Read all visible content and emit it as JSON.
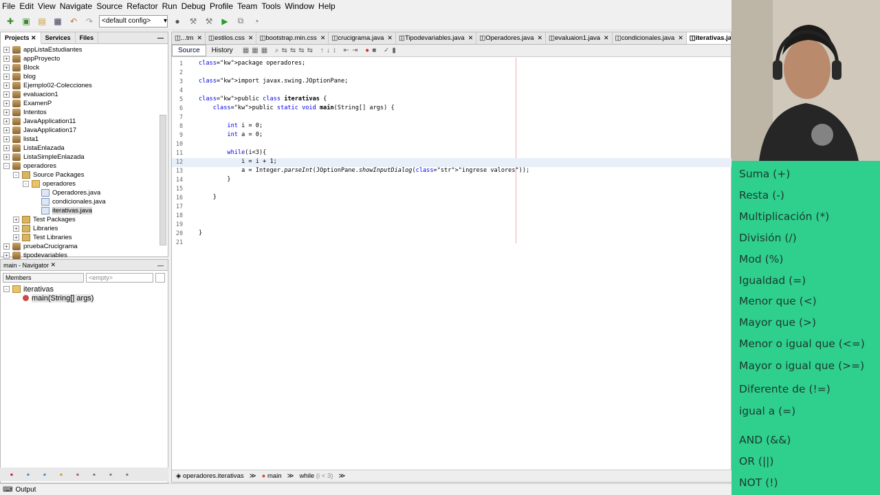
{
  "menu": [
    "File",
    "Edit",
    "View",
    "Navigate",
    "Source",
    "Refactor",
    "Run",
    "Debug",
    "Profile",
    "Team",
    "Tools",
    "Window",
    "Help"
  ],
  "toolbar": {
    "config": "<default config>"
  },
  "left_tabs": [
    "Projects",
    "Services",
    "Files"
  ],
  "tree": [
    {
      "label": "appListaEstudiantes",
      "level": 0,
      "icon": "proj",
      "toggle": "+"
    },
    {
      "label": "appProyecto",
      "level": 0,
      "icon": "proj",
      "toggle": "+"
    },
    {
      "label": "Block",
      "level": 0,
      "icon": "proj",
      "toggle": "+"
    },
    {
      "label": "blog",
      "level": 0,
      "icon": "proj",
      "toggle": "+"
    },
    {
      "label": "Ejemplo02-Colecciones",
      "level": 0,
      "icon": "proj",
      "toggle": "+"
    },
    {
      "label": "evaluacion1",
      "level": 0,
      "icon": "proj",
      "toggle": "+"
    },
    {
      "label": "ExamenP",
      "level": 0,
      "icon": "proj",
      "toggle": "+"
    },
    {
      "label": "Intentos",
      "level": 0,
      "icon": "proj",
      "toggle": "+"
    },
    {
      "label": "JavaApplication11",
      "level": 0,
      "icon": "proj",
      "toggle": "+"
    },
    {
      "label": "JavaApplication17",
      "level": 0,
      "icon": "proj",
      "toggle": "+"
    },
    {
      "label": "lista1",
      "level": 0,
      "icon": "proj",
      "toggle": "+"
    },
    {
      "label": "ListaEnlazada",
      "level": 0,
      "icon": "proj",
      "toggle": "+"
    },
    {
      "label": "ListaSimpleEnlazada",
      "level": 0,
      "icon": "proj",
      "toggle": "+"
    },
    {
      "label": "operadores",
      "level": 0,
      "icon": "proj",
      "toggle": "-"
    },
    {
      "label": "Source Packages",
      "level": 1,
      "icon": "folder",
      "toggle": "-"
    },
    {
      "label": "operadores",
      "level": 2,
      "icon": "pkg",
      "toggle": "-"
    },
    {
      "label": "Operadores.java",
      "level": 3,
      "icon": "java",
      "toggle": ""
    },
    {
      "label": "condicionales.java",
      "level": 3,
      "icon": "java",
      "toggle": ""
    },
    {
      "label": "iterativas.java",
      "level": 3,
      "icon": "java",
      "toggle": "",
      "selected": true
    },
    {
      "label": "Test Packages",
      "level": 1,
      "icon": "folder",
      "toggle": "+"
    },
    {
      "label": "Libraries",
      "level": 1,
      "icon": "folder",
      "toggle": "+"
    },
    {
      "label": "Test Libraries",
      "level": 1,
      "icon": "folder",
      "toggle": "+"
    },
    {
      "label": "pruebaCrucigrama",
      "level": 0,
      "icon": "proj",
      "toggle": "+"
    },
    {
      "label": "tipodevariables",
      "level": 0,
      "icon": "proj",
      "toggle": "+"
    }
  ],
  "navigator": {
    "title": "main - Navigator",
    "members": "Members",
    "empty": "<empty>",
    "class_name": "iterativas",
    "method": "main(String[] args)"
  },
  "file_tabs": [
    {
      "label": "...tm",
      "active": false
    },
    {
      "label": "estilos.css",
      "active": false
    },
    {
      "label": "bootstrap.min.css",
      "active": false
    },
    {
      "label": "crucigrama.java",
      "active": false
    },
    {
      "label": "Tipodevariables.java",
      "active": false
    },
    {
      "label": "Operadores.java",
      "active": false
    },
    {
      "label": "evaluaion1.java",
      "active": false
    },
    {
      "label": "condicionales.java",
      "active": false
    },
    {
      "label": "iterativas.ja",
      "active": true
    }
  ],
  "editor_modes": {
    "source": "Source",
    "history": "History"
  },
  "code": [
    "package operadores;",
    "",
    "import javax.swing.JOptionPane;",
    "",
    "public class iterativas {",
    "    public static void main(String[] args) {",
    "",
    "        int i = 0;",
    "        int a = 0;",
    "",
    "        while(i<3){",
    "            i = i + 1;",
    "            a = Integer.parseInt(JOptionPane.showInputDialog(\"ingrese valores\"));",
    "        }",
    "",
    "    }",
    "",
    "",
    "",
    "}",
    ""
  ],
  "breadcrumb": {
    "cls": "operadores.iterativas",
    "method": "main",
    "loop": "while",
    "cond": "(i < 3)"
  },
  "output_label": "Output",
  "operators": [
    "Suma (+)",
    "Resta (-)",
    "Multiplicación (*)",
    "División (/)",
    "Mod (%)",
    "Igualdad (=)",
    "Menor que (<)",
    "Mayor que (>)",
    "Menor o igual que (<=)",
    "Mayor o igual que (>=)",
    "Diferente de (!=)",
    "igual a (=)",
    "AND (&&)",
    "OR (||)",
    "NOT (!)"
  ],
  "colors": {
    "sidebar_bg": "#2fcf8e",
    "keyword": "#0000e6",
    "string": "#ce7b00"
  }
}
